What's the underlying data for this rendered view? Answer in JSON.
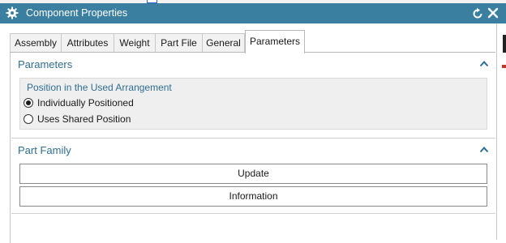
{
  "window": {
    "title": "Component Properties",
    "icons": {
      "app": "gear-icon",
      "reset": "reset-icon",
      "close": "close-icon"
    },
    "colors": {
      "titlebar": "#3a7fa0",
      "accent_text": "#2f6e94"
    }
  },
  "tabs": [
    {
      "label": "Assembly",
      "active": false
    },
    {
      "label": "Attributes",
      "active": false
    },
    {
      "label": "Weight",
      "active": false
    },
    {
      "label": "Part File",
      "active": false
    },
    {
      "label": "General",
      "active": false
    },
    {
      "label": "Parameters",
      "active": true
    }
  ],
  "parameters_group": {
    "title": "Parameters",
    "chevron": "chevron-up-icon",
    "position_section": {
      "title": "Position in the Used Arrangement",
      "options": [
        {
          "label": "Individually Positioned",
          "selected": true
        },
        {
          "label": "Uses Shared Position",
          "selected": false
        }
      ]
    }
  },
  "part_family_group": {
    "title": "Part Family",
    "chevron": "chevron-up-icon",
    "buttons": {
      "update": "Update",
      "information": "Information"
    }
  }
}
